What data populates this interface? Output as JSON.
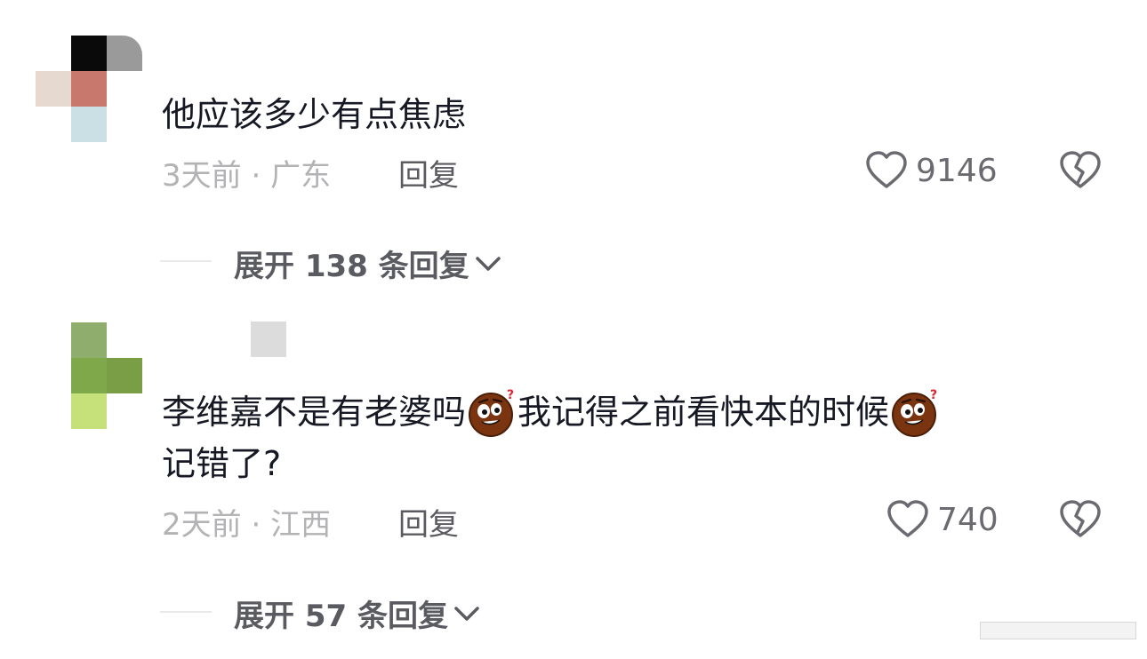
{
  "comments": [
    {
      "text": "他应该多少有点焦虑",
      "time": "3天前",
      "separator": "·",
      "location": "广东",
      "reply_label": "回复",
      "likes": "9146",
      "expand_label": "展开 138 条回复"
    },
    {
      "text_part1": "李维嘉不是有老婆吗",
      "text_part2": "我记得之前看快本的时候",
      "text_line2": "记错了?",
      "time": "2天前",
      "separator": "·",
      "location": "江西",
      "reply_label": "回复",
      "likes": "740",
      "expand_label": "展开 57 条回复"
    }
  ],
  "icons": {
    "like": "heart-outline-icon",
    "dislike": "broken-heart-icon",
    "expand": "chevron-down-icon",
    "emoji": "thinking-face-emoji"
  }
}
